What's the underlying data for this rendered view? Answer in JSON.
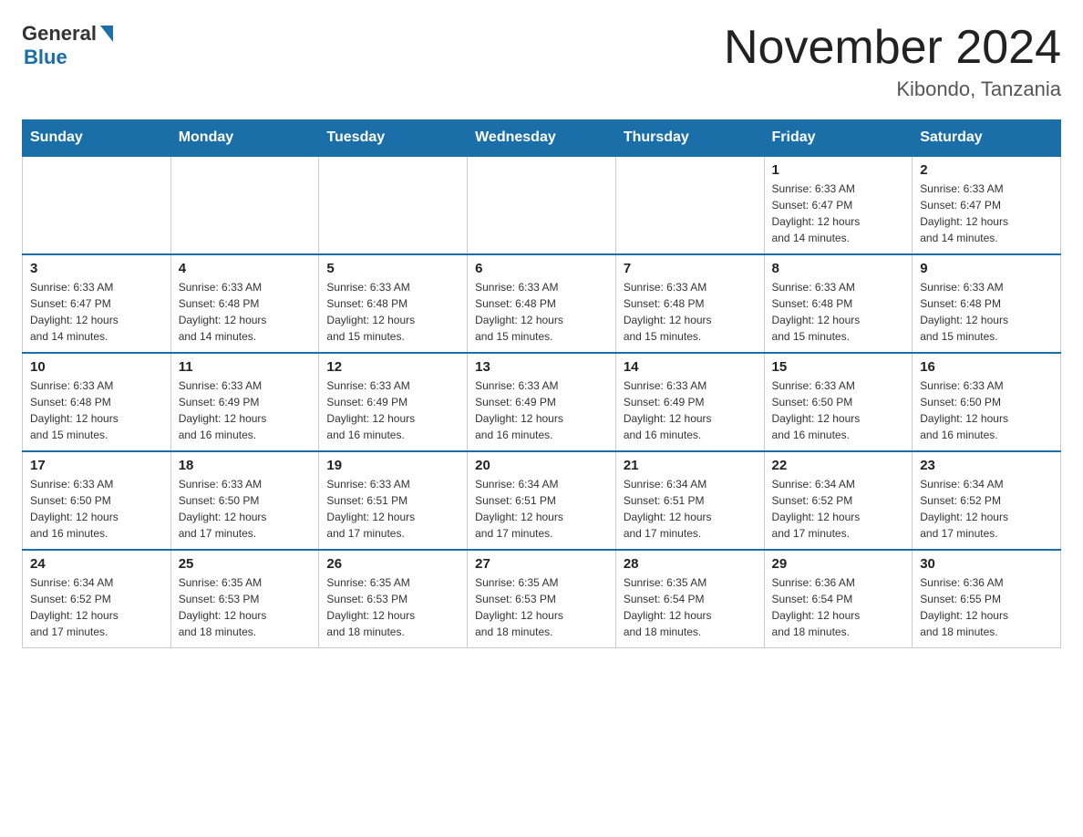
{
  "header": {
    "logo_general": "General",
    "logo_blue": "Blue",
    "month_title": "November 2024",
    "location": "Kibondo, Tanzania"
  },
  "days_of_week": [
    "Sunday",
    "Monday",
    "Tuesday",
    "Wednesday",
    "Thursday",
    "Friday",
    "Saturday"
  ],
  "weeks": [
    {
      "days": [
        {
          "num": "",
          "info": ""
        },
        {
          "num": "",
          "info": ""
        },
        {
          "num": "",
          "info": ""
        },
        {
          "num": "",
          "info": ""
        },
        {
          "num": "",
          "info": ""
        },
        {
          "num": "1",
          "info": "Sunrise: 6:33 AM\nSunset: 6:47 PM\nDaylight: 12 hours\nand 14 minutes."
        },
        {
          "num": "2",
          "info": "Sunrise: 6:33 AM\nSunset: 6:47 PM\nDaylight: 12 hours\nand 14 minutes."
        }
      ]
    },
    {
      "days": [
        {
          "num": "3",
          "info": "Sunrise: 6:33 AM\nSunset: 6:47 PM\nDaylight: 12 hours\nand 14 minutes."
        },
        {
          "num": "4",
          "info": "Sunrise: 6:33 AM\nSunset: 6:48 PM\nDaylight: 12 hours\nand 14 minutes."
        },
        {
          "num": "5",
          "info": "Sunrise: 6:33 AM\nSunset: 6:48 PM\nDaylight: 12 hours\nand 15 minutes."
        },
        {
          "num": "6",
          "info": "Sunrise: 6:33 AM\nSunset: 6:48 PM\nDaylight: 12 hours\nand 15 minutes."
        },
        {
          "num": "7",
          "info": "Sunrise: 6:33 AM\nSunset: 6:48 PM\nDaylight: 12 hours\nand 15 minutes."
        },
        {
          "num": "8",
          "info": "Sunrise: 6:33 AM\nSunset: 6:48 PM\nDaylight: 12 hours\nand 15 minutes."
        },
        {
          "num": "9",
          "info": "Sunrise: 6:33 AM\nSunset: 6:48 PM\nDaylight: 12 hours\nand 15 minutes."
        }
      ]
    },
    {
      "days": [
        {
          "num": "10",
          "info": "Sunrise: 6:33 AM\nSunset: 6:48 PM\nDaylight: 12 hours\nand 15 minutes."
        },
        {
          "num": "11",
          "info": "Sunrise: 6:33 AM\nSunset: 6:49 PM\nDaylight: 12 hours\nand 16 minutes."
        },
        {
          "num": "12",
          "info": "Sunrise: 6:33 AM\nSunset: 6:49 PM\nDaylight: 12 hours\nand 16 minutes."
        },
        {
          "num": "13",
          "info": "Sunrise: 6:33 AM\nSunset: 6:49 PM\nDaylight: 12 hours\nand 16 minutes."
        },
        {
          "num": "14",
          "info": "Sunrise: 6:33 AM\nSunset: 6:49 PM\nDaylight: 12 hours\nand 16 minutes."
        },
        {
          "num": "15",
          "info": "Sunrise: 6:33 AM\nSunset: 6:50 PM\nDaylight: 12 hours\nand 16 minutes."
        },
        {
          "num": "16",
          "info": "Sunrise: 6:33 AM\nSunset: 6:50 PM\nDaylight: 12 hours\nand 16 minutes."
        }
      ]
    },
    {
      "days": [
        {
          "num": "17",
          "info": "Sunrise: 6:33 AM\nSunset: 6:50 PM\nDaylight: 12 hours\nand 16 minutes."
        },
        {
          "num": "18",
          "info": "Sunrise: 6:33 AM\nSunset: 6:50 PM\nDaylight: 12 hours\nand 17 minutes."
        },
        {
          "num": "19",
          "info": "Sunrise: 6:33 AM\nSunset: 6:51 PM\nDaylight: 12 hours\nand 17 minutes."
        },
        {
          "num": "20",
          "info": "Sunrise: 6:34 AM\nSunset: 6:51 PM\nDaylight: 12 hours\nand 17 minutes."
        },
        {
          "num": "21",
          "info": "Sunrise: 6:34 AM\nSunset: 6:51 PM\nDaylight: 12 hours\nand 17 minutes."
        },
        {
          "num": "22",
          "info": "Sunrise: 6:34 AM\nSunset: 6:52 PM\nDaylight: 12 hours\nand 17 minutes."
        },
        {
          "num": "23",
          "info": "Sunrise: 6:34 AM\nSunset: 6:52 PM\nDaylight: 12 hours\nand 17 minutes."
        }
      ]
    },
    {
      "days": [
        {
          "num": "24",
          "info": "Sunrise: 6:34 AM\nSunset: 6:52 PM\nDaylight: 12 hours\nand 17 minutes."
        },
        {
          "num": "25",
          "info": "Sunrise: 6:35 AM\nSunset: 6:53 PM\nDaylight: 12 hours\nand 18 minutes."
        },
        {
          "num": "26",
          "info": "Sunrise: 6:35 AM\nSunset: 6:53 PM\nDaylight: 12 hours\nand 18 minutes."
        },
        {
          "num": "27",
          "info": "Sunrise: 6:35 AM\nSunset: 6:53 PM\nDaylight: 12 hours\nand 18 minutes."
        },
        {
          "num": "28",
          "info": "Sunrise: 6:35 AM\nSunset: 6:54 PM\nDaylight: 12 hours\nand 18 minutes."
        },
        {
          "num": "29",
          "info": "Sunrise: 6:36 AM\nSunset: 6:54 PM\nDaylight: 12 hours\nand 18 minutes."
        },
        {
          "num": "30",
          "info": "Sunrise: 6:36 AM\nSunset: 6:55 PM\nDaylight: 12 hours\nand 18 minutes."
        }
      ]
    }
  ]
}
